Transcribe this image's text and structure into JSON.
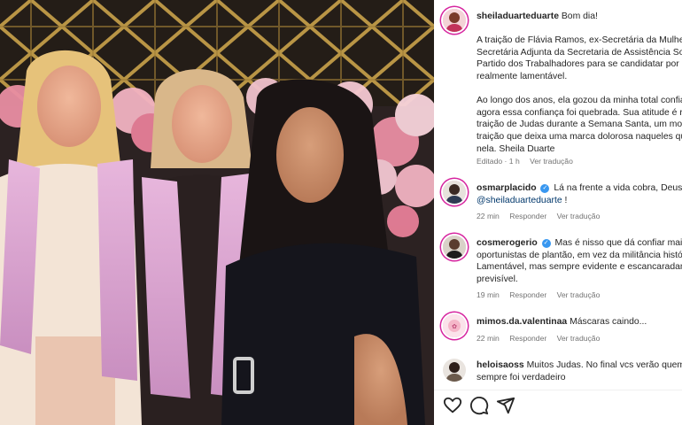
{
  "post": {
    "author": "sheiladuarteduarte",
    "greeting": "Bom dia!",
    "caption_lines_p1": [
      "A traição de Flávia Ramos, ex-Secretária da Mulher e",
      "Secretária Adjunta da Secretaria de Assistência Social",
      "Partido dos Trabalhadores para se candidatar por ou",
      "realmente lamentável."
    ],
    "caption_lines_p2": [
      "Ao longo dos anos, ela gozou da minha total confiança",
      "agora essa confiança foi quebrada. Sua atitude é rem",
      "traição de Judas durante a Semana Santa, um mome",
      "traição que deixa uma marca dolorosa naqueles que",
      "nela. Sheila Duarte"
    ],
    "edited_time": "Editado · 1 h",
    "see_translation": "Ver tradução"
  },
  "comments": [
    {
      "user": "osmarplacido",
      "verified": true,
      "lines": [
        "Lá na frente a vida cobra, Deus a f"
      ],
      "mention": "@sheiladuarteduarte",
      "mention_suffix": " !",
      "time": "22 min",
      "reply": "Responder",
      "translate": "Ver tradução"
    },
    {
      "user": "cosmerogerio",
      "verified": true,
      "lines": [
        "Mas é nisso que dá confiar mais n",
        "oportunistas de plantão, em vez da militância histó",
        "Lamentável, mas sempre evidente e escancaradame",
        "previsível."
      ],
      "time": "19 min",
      "reply": "Responder",
      "translate": "Ver tradução"
    },
    {
      "user": "mimos.da.valentinaa",
      "verified": false,
      "lines": [
        "Máscaras caindo..."
      ],
      "time": "22 min",
      "reply": "Responder",
      "translate": "Ver tradução"
    },
    {
      "user": "heloisaoss",
      "verified": false,
      "lines": [
        "Muitos Judas. No final vcs verão quem r",
        "sempre foi verdadeiro"
      ]
    }
  ],
  "actions": {
    "like_icon": "heart-icon",
    "comment_icon": "comment-icon",
    "share_icon": "share-icon"
  },
  "colors": {
    "verified": "#3897f0",
    "link": "#00376b",
    "meta": "#737373"
  }
}
